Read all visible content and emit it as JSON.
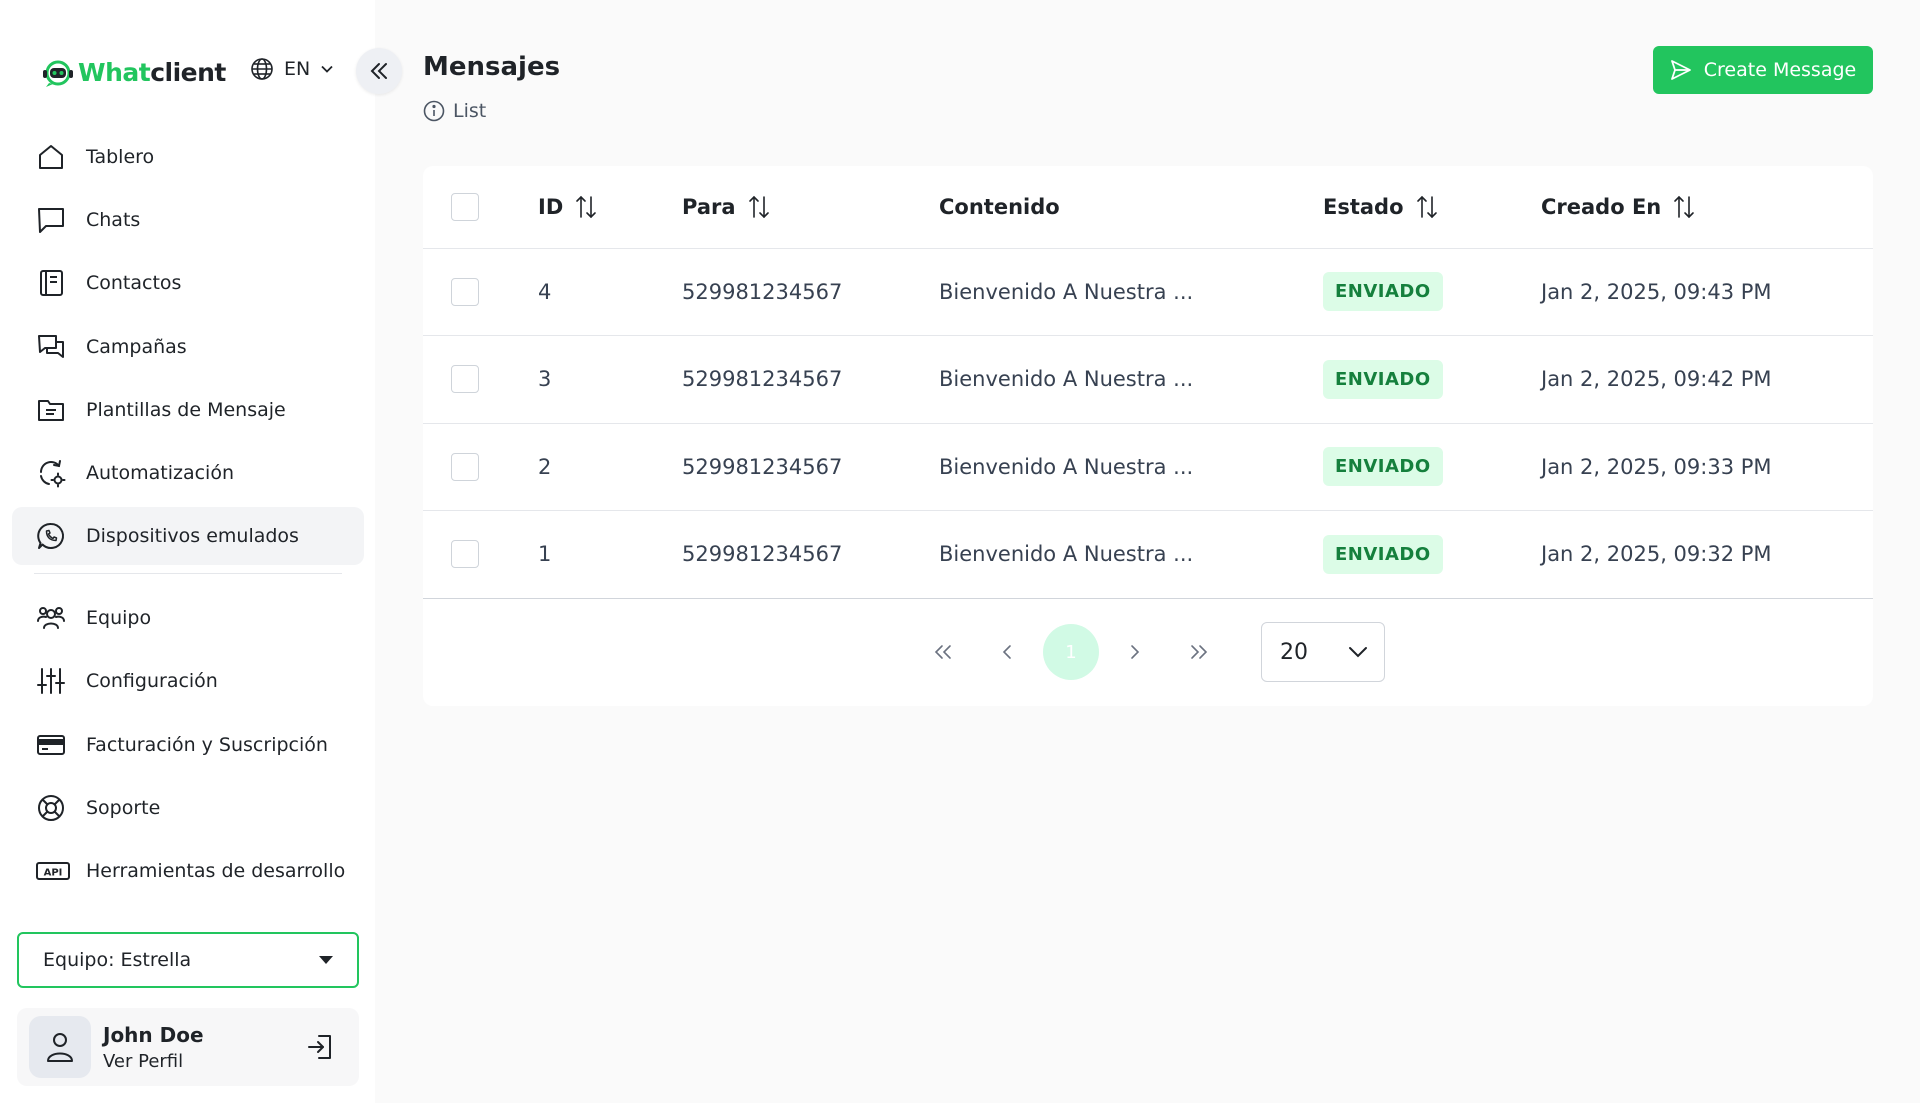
{
  "brand": {
    "name_part1": "What",
    "name_part2": "client"
  },
  "language": {
    "code": "EN"
  },
  "sidebar": {
    "items": [
      {
        "id": "tablero",
        "label": "Tablero",
        "icon": "home-icon"
      },
      {
        "id": "chats",
        "label": "Chats",
        "icon": "chat-icon"
      },
      {
        "id": "contactos",
        "label": "Contactos",
        "icon": "contacts-icon"
      },
      {
        "id": "campanas",
        "label": "Campañas",
        "icon": "campaigns-icon"
      },
      {
        "id": "plantillas",
        "label": "Plantillas de Mensaje",
        "icon": "folder-icon"
      },
      {
        "id": "automatizacion",
        "label": "Automatización",
        "icon": "automation-icon"
      },
      {
        "id": "dispositivos",
        "label": "Dispositivos emulados",
        "icon": "whatsapp-icon",
        "active": true
      }
    ],
    "items2": [
      {
        "id": "equipo",
        "label": "Equipo",
        "icon": "team-icon"
      },
      {
        "id": "configuracion",
        "label": "Configuración",
        "icon": "sliders-icon"
      },
      {
        "id": "facturacion",
        "label": "Facturación y Suscripción",
        "icon": "credit-card-icon"
      },
      {
        "id": "soporte",
        "label": "Soporte",
        "icon": "lifebuoy-icon"
      },
      {
        "id": "herramientas",
        "label": "Herramientas de desarrollo",
        "icon": "api-icon"
      }
    ]
  },
  "team_select": {
    "value": "Equipo: Estrella"
  },
  "profile": {
    "name": "John Doe",
    "link": "Ver Perfil"
  },
  "header": {
    "title": "Mensajes",
    "subtitle": "List",
    "create_button": "Create Message"
  },
  "table": {
    "columns": [
      "ID",
      "Para",
      "Contenido",
      "Estado",
      "Creado En"
    ],
    "rows": [
      {
        "id": "4",
        "to": "529981234567",
        "content": "Bienvenido A Nuestra ...",
        "status": "ENVIADO",
        "created": "Jan 2, 2025, 09:43 PM"
      },
      {
        "id": "3",
        "to": "529981234567",
        "content": "Bienvenido A Nuestra ...",
        "status": "ENVIADO",
        "created": "Jan 2, 2025, 09:42 PM"
      },
      {
        "id": "2",
        "to": "529981234567",
        "content": "Bienvenido A Nuestra ...",
        "status": "ENVIADO",
        "created": "Jan 2, 2025, 09:33 PM"
      },
      {
        "id": "1",
        "to": "529981234567",
        "content": "Bienvenido A Nuestra ...",
        "status": "ENVIADO",
        "created": "Jan 2, 2025, 09:32 PM"
      }
    ]
  },
  "pagination": {
    "current_page": "1",
    "page_size": "20"
  },
  "colors": {
    "accent": "#22c55e",
    "badge_bg": "#dcfce7",
    "badge_text": "#15803d"
  }
}
